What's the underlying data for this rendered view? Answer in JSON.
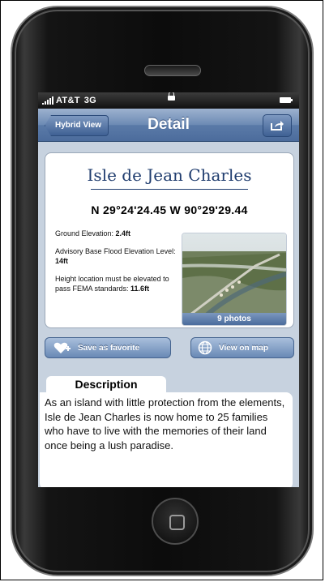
{
  "status_bar": {
    "carrier": "AT&T",
    "network": "3G"
  },
  "nav": {
    "back_label": "Hybrid View",
    "title": "Detail",
    "share_icon": "share-icon"
  },
  "location": {
    "name": "Isle de Jean Charles",
    "coordinates": "N 29°24'24.45  W 90°29'29.44",
    "ground_elevation_label": "Ground Elevation: ",
    "ground_elevation_value": "2.4ft",
    "advisory_label": "Advisory Base Flood Elevation Level: ",
    "advisory_value": "14ft",
    "height_label": "Height location must be elevated to pass FEMA standards: ",
    "height_value": "11.6ft",
    "photos_label": "9 photos"
  },
  "actions": {
    "favorite_label": "Save as favorite",
    "map_label": "View on map"
  },
  "description": {
    "heading": "Description",
    "text": "As an island with little  protection from the elements, Isle de Jean Charles is now home to 25 families who have to live with the memories of their land once being a lush paradise."
  },
  "colors": {
    "nav_blue": "#5a7aa8",
    "title_blue": "#1f3c6e",
    "screen_bg": "#c7d2df"
  }
}
